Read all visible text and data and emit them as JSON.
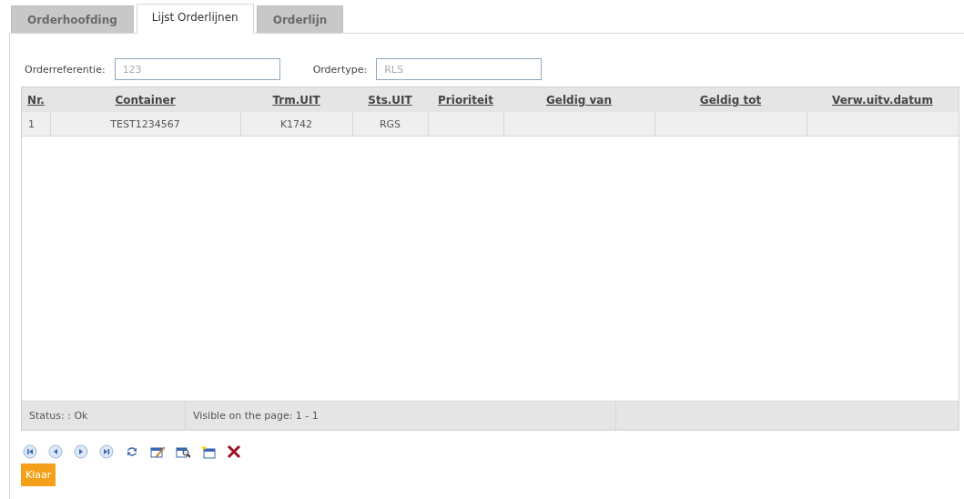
{
  "tabs": [
    {
      "label": "Orderhoofding",
      "selected": false
    },
    {
      "label": "Lijst Orderlijnen",
      "selected": true
    },
    {
      "label": "Orderlijn",
      "selected": false
    }
  ],
  "fields": [
    {
      "label": "Orderreferentie:",
      "placeholder": "123"
    },
    {
      "label": "Ordertype:",
      "placeholder": "RLS"
    }
  ],
  "table": {
    "columns": [
      "Nr.",
      "Container",
      "Trm.UIT",
      "Sts.UIT",
      "Prioriteit",
      "Geldig van",
      "Geldig tot",
      "Verw.uitv.datum"
    ],
    "rows": [
      {
        "cells": [
          "1",
          "TEST1234567",
          "K1742",
          "RGS",
          "",
          "",
          "",
          ""
        ]
      }
    ]
  },
  "status_bar": [
    "Status: : Ok",
    "Visible on the page: 1 - 1"
  ],
  "toolbar": [
    {
      "kind": "first"
    },
    {
      "kind": "prev"
    },
    {
      "kind": "next"
    },
    {
      "kind": "last"
    },
    {
      "kind": "refresh"
    },
    {
      "kind": "edit"
    },
    {
      "kind": "view"
    },
    {
      "kind": "new"
    },
    {
      "kind": "delete"
    }
  ],
  "button": "Klaar"
}
